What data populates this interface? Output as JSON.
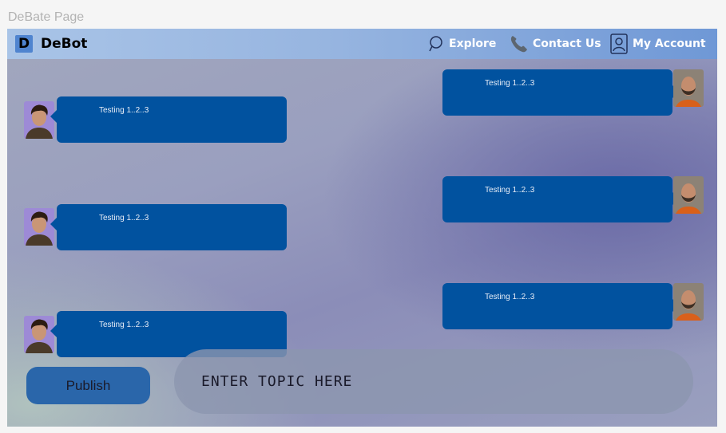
{
  "page": {
    "label": "DeBate Page"
  },
  "navbar": {
    "logo_letter": "D",
    "brand": "DeBot",
    "items": [
      {
        "label": "Explore",
        "icon": "search-icon"
      },
      {
        "label": "Contact Us",
        "icon": "phone-icon"
      },
      {
        "label": "My Account",
        "icon": "user-icon"
      }
    ]
  },
  "messages": [
    {
      "side": "left",
      "text": "Testing 1..2..3",
      "avatar": "young-man-avatar"
    },
    {
      "side": "right",
      "text": "Testing 1..2..3",
      "avatar": "bearded-man-avatar"
    },
    {
      "side": "left",
      "text": "Testing 1..2..3",
      "avatar": "young-man-avatar"
    },
    {
      "side": "right",
      "text": "Testing 1..2..3",
      "avatar": "bearded-man-avatar"
    },
    {
      "side": "left",
      "text": "Testing 1..2..3",
      "avatar": "young-man-avatar"
    },
    {
      "side": "right",
      "text": "Testing 1..2..3",
      "avatar": "bearded-man-avatar"
    }
  ],
  "composer": {
    "publish_label": "Publish",
    "topic_placeholder": "ENTER TOPIC HERE"
  },
  "colors": {
    "bubble": "#01529f",
    "publish": "#2a66aa",
    "navbar_end": "#6f98d6"
  }
}
